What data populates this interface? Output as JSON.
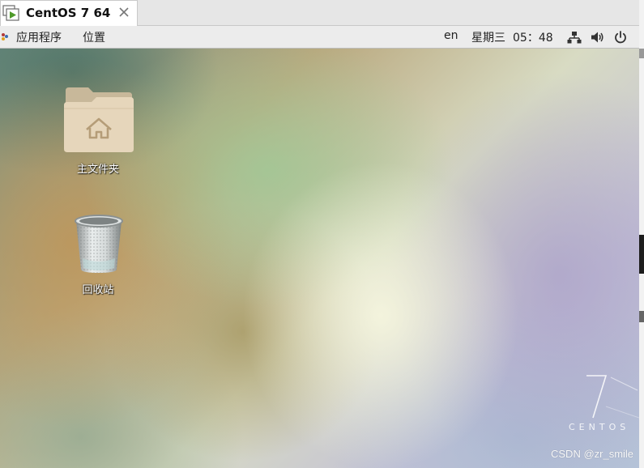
{
  "vm_tab": {
    "title": "CentOS 7 64",
    "icon": "vm-play-icon",
    "close_icon": "close-icon"
  },
  "topbar": {
    "applications_label": "应用程序",
    "places_label": "位置",
    "keyboard_layout": "en",
    "day": "星期三",
    "time": "05：48",
    "icons": [
      "network-icon",
      "volume-icon",
      "power-icon"
    ]
  },
  "desktop": {
    "icons": [
      {
        "label": "主文件夹",
        "icon": "home-folder-icon"
      },
      {
        "label": "回收站",
        "icon": "trash-icon"
      }
    ],
    "logo_number": "7",
    "logo_text": "CENTOS"
  },
  "watermark": "CSDN @zr_smile",
  "colors": {
    "topbar_bg": "#ececec",
    "tab_bg": "#ffffff",
    "play_green": "#4f9a2a"
  }
}
